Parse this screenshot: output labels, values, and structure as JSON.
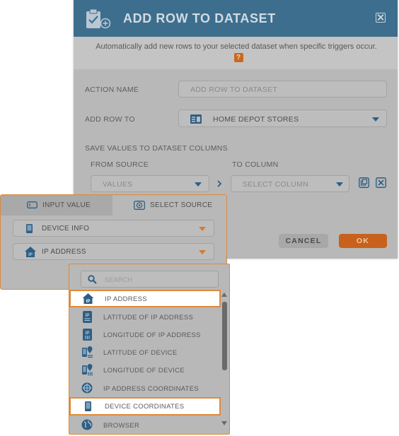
{
  "dialog": {
    "title": "ADD ROW TO DATASET",
    "subtitle": "Automatically add new rows to your selected dataset when specific triggers occur.",
    "help_badge": "?",
    "action_name_label": "ACTION NAME",
    "action_name_placeholder": "ADD ROW TO DATASET",
    "add_row_to_label": "ADD ROW TO",
    "add_row_to_value": "HOME DEPOT STORES",
    "save_values_label": "SAVE VALUES TO DATASET COLUMNS",
    "from_source_label": "FROM SOURCE",
    "to_column_label": "TO COLUMN",
    "from_source_value": "VALUES",
    "to_column_value": "SELECT COLUMN",
    "cancel_label": "CANCEL",
    "ok_label": "OK"
  },
  "source_popover": {
    "tabs": [
      {
        "label": "INPUT VALUE",
        "icon": "input-value-icon",
        "active": false
      },
      {
        "label": "SELECT SOURCE",
        "icon": "target-icon",
        "active": true
      }
    ],
    "source_dropdown": "DEVICE INFO",
    "field_dropdown": "IP ADDRESS"
  },
  "list_popover": {
    "search_placeholder": "SEARCH",
    "items": [
      {
        "label": "IP ADDRESS",
        "icon": "ip-home-icon",
        "selected": true
      },
      {
        "label": "LATITUDE OF IP ADDRESS",
        "icon": "ip-lat-icon",
        "selected": false
      },
      {
        "label": "LONGITUDE OF IP ADDRESS",
        "icon": "ip-long-icon",
        "selected": false
      },
      {
        "label": "LATITUDE OF DEVICE",
        "icon": "device-lat-icon",
        "selected": false
      },
      {
        "label": "LONGITUDE OF DEVICE",
        "icon": "device-long-icon",
        "selected": false
      },
      {
        "label": "IP ADDRESS COORDINATES",
        "icon": "crosshair-icon",
        "selected": false
      },
      {
        "label": "DEVICE COORDINATES",
        "icon": "phone-icon",
        "selected": false
      },
      {
        "label": "BROWSER",
        "icon": "globe-icon",
        "selected": false
      }
    ]
  },
  "colors": {
    "header": "#3d6e8d",
    "accent_orange": "#c8611c",
    "icon_blue": "#2d5f86"
  }
}
